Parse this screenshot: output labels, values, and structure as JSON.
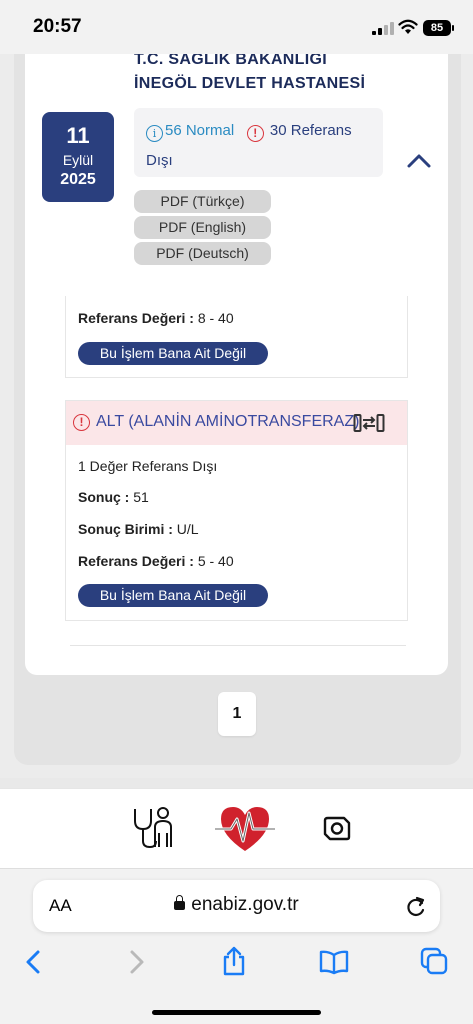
{
  "status": {
    "time": "20:57",
    "battery": "85"
  },
  "report": {
    "hospital_line1": "T.C. SAĞLIK BAKANLIĞI",
    "hospital_line2": "İNEGÖL DEVLET HASTANESİ",
    "date": {
      "day": "11",
      "month": "Eylül",
      "year": "2025"
    },
    "summary": {
      "normal": "56 Normal",
      "out_of_ref": "30 Referans",
      "out_of_ref_cont": "Dışı"
    },
    "pdf_buttons": [
      "PDF (Türkçe)",
      "PDF (English)",
      "PDF (Deutsch)"
    ]
  },
  "prev_result": {
    "ref_label": "Referans Değeri :",
    "ref_value": "8 - 40",
    "not_mine": "Bu İşlem Bana Ait Değil"
  },
  "test": {
    "name": "ALT (ALANİN AMİNOTRANSFERAZ)",
    "out_count": "1 Değer Referans Dışı",
    "result_label": "Sonuç :",
    "result_value": "51",
    "unit_label": "Sonuç Birimi :",
    "unit_value": "U/L",
    "ref_label": "Referans Değeri :",
    "ref_value": "5 - 40",
    "not_mine": "Bu İşlem Bana Ait Değil"
  },
  "pagination": {
    "current": "1"
  },
  "browser": {
    "aa": "AA",
    "url": "enabiz.gov.tr"
  },
  "icons": {
    "info": "info-circle-icon",
    "warning": "exclamation-circle-icon",
    "collapse": "chevron-up-icon",
    "compare": "compare-icon",
    "doctor": "doctor-icon",
    "logo": "enabiz-heart-logo",
    "camera": "camera-icon"
  },
  "colors": {
    "primary": "#2a3f7e",
    "info": "#2a8bc2",
    "alert": "#d9363e",
    "alert_bg": "#fbe6e8",
    "link": "#1a7cf5"
  }
}
